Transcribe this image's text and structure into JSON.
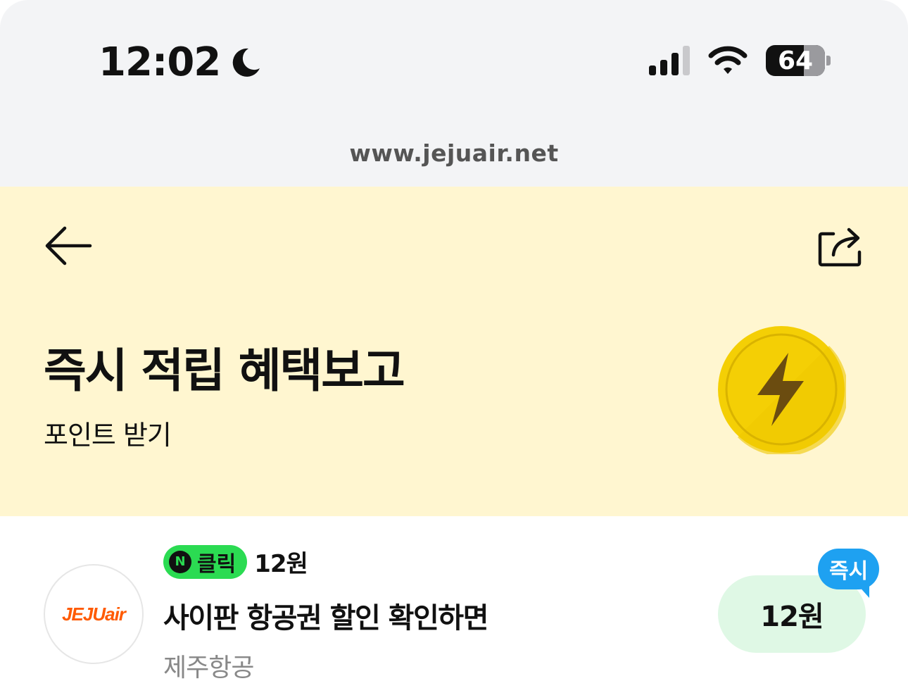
{
  "status_bar": {
    "time": "12:02",
    "battery": "64",
    "icons": [
      "moon-icon",
      "signal-icon",
      "wifi-icon",
      "battery-icon"
    ]
  },
  "browser": {
    "url": "www.jejuair.net"
  },
  "hero": {
    "title": "즉시 적립 혜택보고",
    "subtitle": "포인트 받기",
    "icons": [
      "back-arrow-icon",
      "share-icon",
      "lightning-coin-icon"
    ],
    "background_color": "#fff6d0"
  },
  "offer": {
    "logo_text": "JEJUair",
    "badge_label": "클릭",
    "badge_amount": "12원",
    "title": "사이판 항공권 할인 확인하면",
    "advertiser": "제주항공",
    "reward": "12원",
    "instant_label": "즉시",
    "colors": {
      "badge": "#2bdb52",
      "reward_button": "#dff8e5",
      "instant_bubble": "#1ea1f1",
      "logo": "#ff5a00"
    }
  }
}
